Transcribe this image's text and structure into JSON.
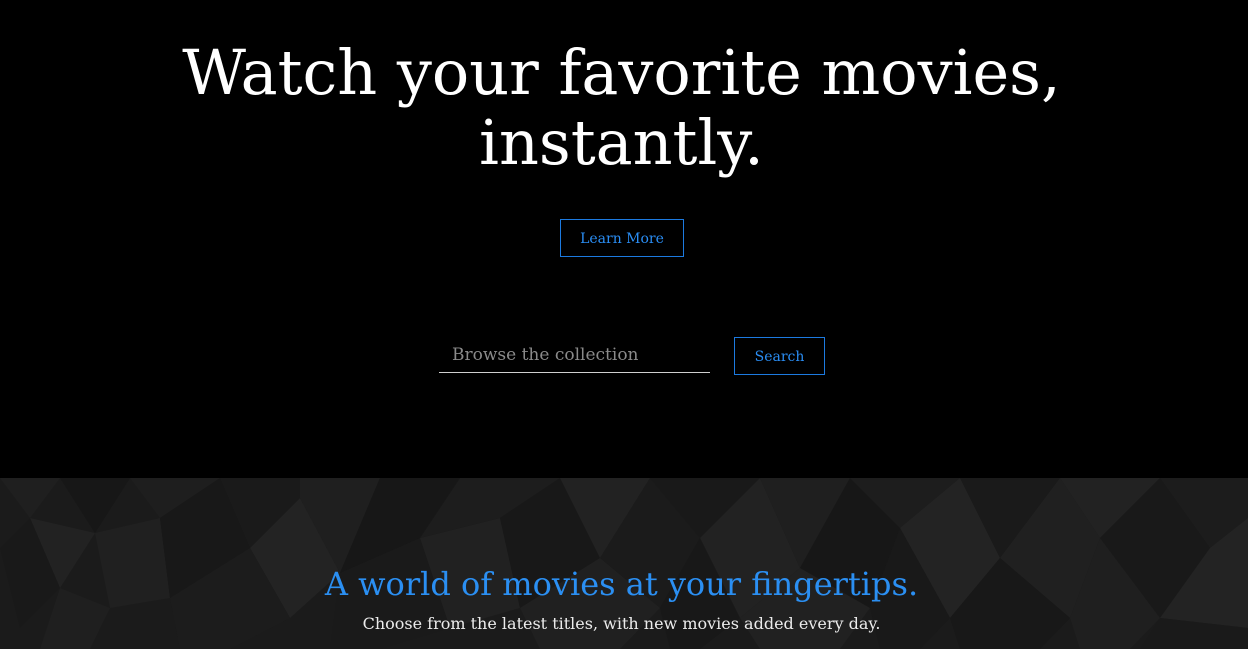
{
  "hero": {
    "title_line1": "Watch your favorite movies,",
    "title_line2": "instantly.",
    "learn_more_label": "Learn More"
  },
  "search": {
    "placeholder": "Browse the collection",
    "value": "",
    "button_label": "Search"
  },
  "features": {
    "heading": "A world of movies at your fingertips.",
    "subheading": "Choose from the latest titles, with new movies added every day."
  },
  "colors": {
    "accent": "#2a8ef5",
    "hero_bg": "#000000",
    "features_bg": "#1b1b1b"
  }
}
